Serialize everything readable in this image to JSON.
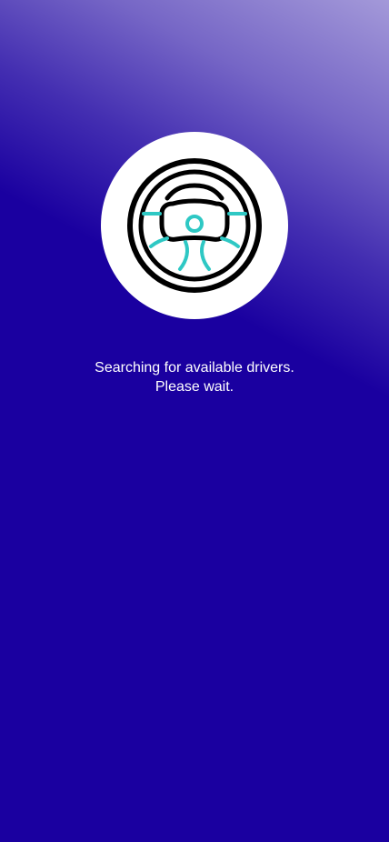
{
  "status": {
    "line1": "Searching for available drivers.",
    "line2": "Please wait."
  },
  "icon": {
    "name": "steering-wheel-icon",
    "outline_color": "#000000",
    "accent_color": "#2ec8c4",
    "circle_color": "#ffffff"
  },
  "colors": {
    "background": "#1a00a0",
    "text": "#ffffff"
  }
}
